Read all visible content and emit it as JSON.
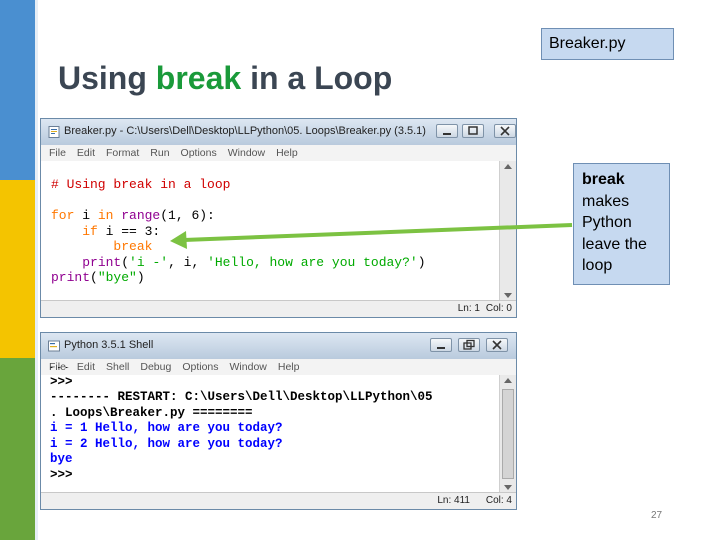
{
  "slide": {
    "file_tag": "Breaker.py",
    "title_pre": "Using ",
    "title_keyword": "break",
    "title_post": " in a Loop",
    "callout_bold": "break",
    "callout_lines": [
      "makes",
      "Python",
      "leave the",
      "loop"
    ],
    "page_number": "27",
    "colors": {
      "title": "#3b4653",
      "keyword": "#1a9a3a",
      "callout_bg": "#c6d9f0",
      "arrow": "#7cc242"
    }
  },
  "editor": {
    "title": "Breaker.py - C:\\Users\\Dell\\Desktop\\LLPython\\05. Loops\\Breaker.py (3.5.1)",
    "menu": [
      "File",
      "Edit",
      "Format",
      "Run",
      "Options",
      "Window",
      "Help"
    ],
    "code": {
      "comment": "# Using break in a loop",
      "l2_for": "for",
      "l2_i": " i ",
      "l2_in": "in",
      "l2_range": " range",
      "l2_rest": "(1, 6):",
      "l3_indent": "    ",
      "l3_if": "if",
      "l3_rest": " i == 3:",
      "l4_indent": "        ",
      "l4_break": "break",
      "l5_indent": "    ",
      "l5_print": "print",
      "l5_open": "(",
      "l5_str1": "'i -'",
      "l5_mid": ", i, ",
      "l5_str2": "'Hello, how are you today?'",
      "l5_close": ")",
      "l6_print": "print",
      "l6_open": "(",
      "l6_str": "\"bye\"",
      "l6_close": ")"
    },
    "status_ln": "Ln: 1",
    "status_col": "Col: 0"
  },
  "shell": {
    "title": "Python 3.5.1 Shell",
    "menu": [
      "File",
      "Edit",
      "Shell",
      "Debug",
      "Options",
      "Window",
      "Help"
    ],
    "lines": {
      "partial": ">>>",
      "prompt1": ">>>",
      "restart1": "-------- RESTART: C:\\Users\\Dell\\Desktop\\LLPython\\05",
      "restart2": ". Loops\\Breaker.py ========",
      "out1": "i = 1 Hello, how are you today?",
      "out2": "i = 2 Hello, how are you today?",
      "out3": "bye",
      "prompt2": ">>>"
    },
    "status_ln": "Ln: 411",
    "status_col": "Col: 4"
  }
}
